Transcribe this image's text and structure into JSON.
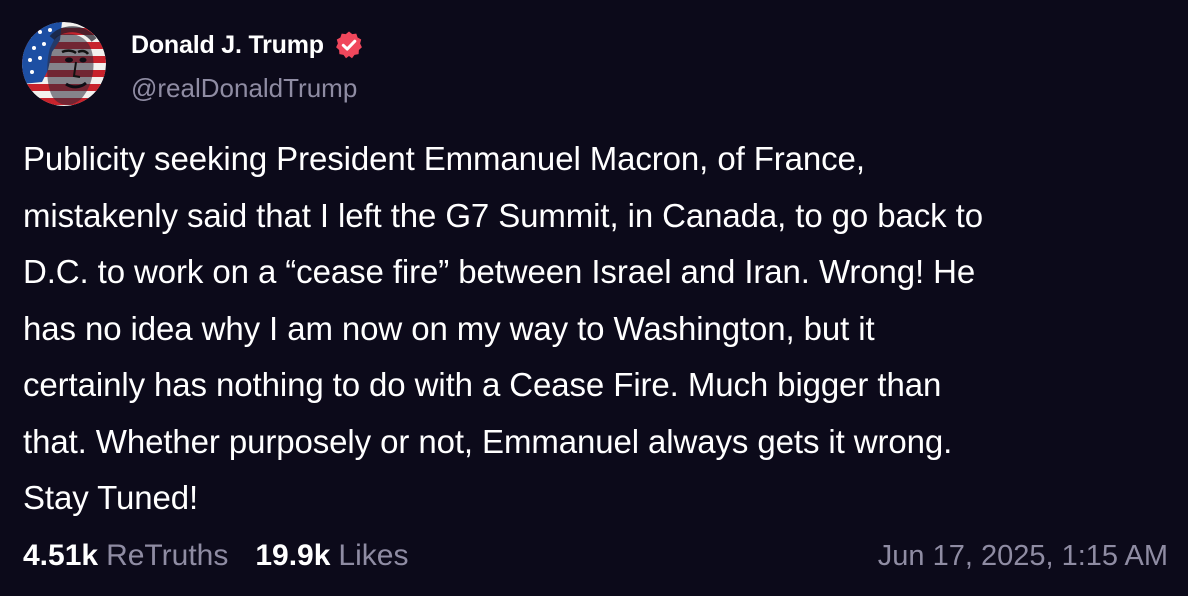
{
  "post": {
    "author": {
      "display_name": "Donald J. Trump",
      "handle": "@realDonaldTrump",
      "verified": true,
      "verified_icon": "verified-badge-icon",
      "verified_color": "#f0475c"
    },
    "body_lines": [
      "Publicity seeking President Emmanuel Macron, of France,",
      "mistakenly said that I left the G7 Summit, in Canada, to go back to",
      "D.C. to work on a “cease fire” between Israel and Iran. Wrong! He",
      "has no idea why I am now on my way to Washington, but it",
      "certainly has nothing to do with a Cease Fire. Much bigger than",
      "that. Whether purposely or not, Emmanuel always gets it wrong.",
      "Stay Tuned!"
    ],
    "stats": {
      "retruths_count": "4.51k",
      "retruths_label": "ReTruths",
      "likes_count": "19.9k",
      "likes_label": "Likes"
    },
    "timestamp": "Jun 17, 2025, 1:15 AM"
  },
  "colors": {
    "background": "#0c0a1a",
    "primary_text": "#ffffff",
    "secondary_text": "#8f8ca3",
    "verified_badge": "#f0475c"
  }
}
